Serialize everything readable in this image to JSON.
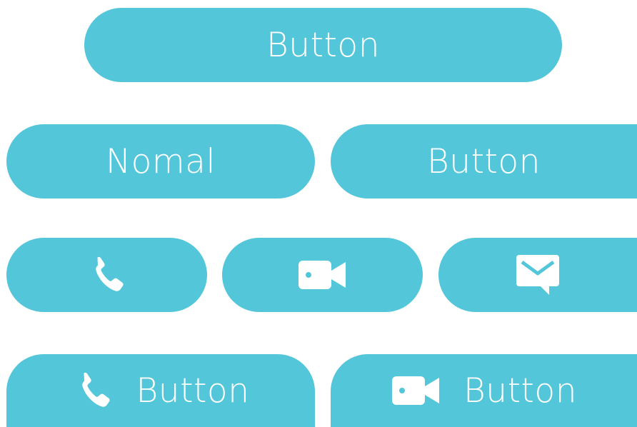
{
  "buttons": {
    "top": {
      "label": "Button"
    },
    "normal": {
      "label": "Nomal"
    },
    "right": {
      "label": "Button"
    },
    "phone_label_button": {
      "label": "Button",
      "icon": "phone-icon"
    },
    "video_label_button": {
      "label": "Button",
      "icon": "video-camera-icon"
    },
    "icon_buttons": [
      {
        "icon": "phone-icon"
      },
      {
        "icon": "video-camera-icon"
      },
      {
        "icon": "message-icon"
      }
    ]
  },
  "colors": {
    "button_bg": "#53c6da",
    "button_fg": "#ffffff"
  }
}
